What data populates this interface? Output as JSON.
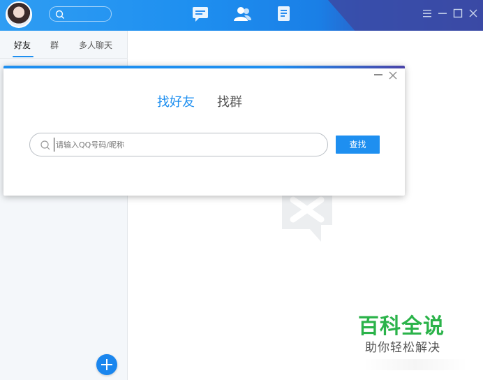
{
  "titlebar": {
    "nav": [
      "chat-icon",
      "contacts-icon",
      "files-icon"
    ],
    "controls": [
      "menu-icon",
      "minimize-icon",
      "maximize-icon",
      "close-icon"
    ]
  },
  "leftpanel": {
    "tabs": [
      {
        "label": "好友",
        "active": true
      },
      {
        "label": "群",
        "active": false
      },
      {
        "label": "多人聊天",
        "active": false
      }
    ]
  },
  "dialog": {
    "tabs": [
      {
        "label": "找好友",
        "active": true
      },
      {
        "label": "找群",
        "active": false
      }
    ],
    "search": {
      "placeholder": "请输入QQ号码/昵称",
      "value": ""
    },
    "find_button": "查找"
  },
  "watermark": {
    "title": "百科全说",
    "subtitle": "助你轻松解决"
  },
  "colors": {
    "accent": "#1e8ff0",
    "brand_green": "#2bb34a"
  }
}
